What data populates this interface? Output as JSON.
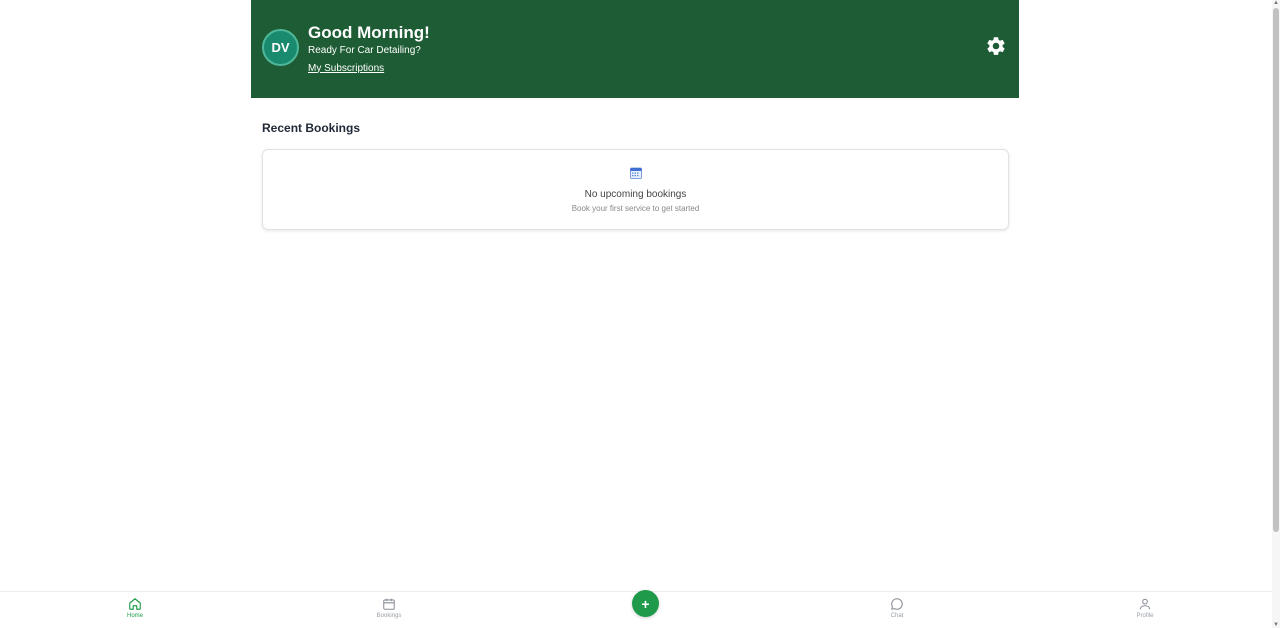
{
  "header": {
    "avatar_initials": "DV",
    "greeting": "Good Morning!",
    "subtitle": "Ready For Car Detailing?",
    "subscriptions_link": "My Subscriptions",
    "settings_icon": "gear-icon",
    "background": "#1e5c35"
  },
  "recent_bookings": {
    "title": "Recent Bookings",
    "empty_icon": "calendar-icon",
    "empty_title": "No upcoming bookings",
    "empty_subtitle": "Book your first service to get started"
  },
  "bottom_nav": {
    "items": [
      {
        "label": "Home",
        "icon": "home-icon",
        "active": true
      },
      {
        "label": "Bookings",
        "icon": "calendar-icon",
        "active": false
      },
      {
        "label": "Chat",
        "icon": "chat-icon",
        "active": false
      },
      {
        "label": "Profile",
        "icon": "user-icon",
        "active": false
      }
    ],
    "fab_label": "+",
    "accent": "#22a04a"
  }
}
